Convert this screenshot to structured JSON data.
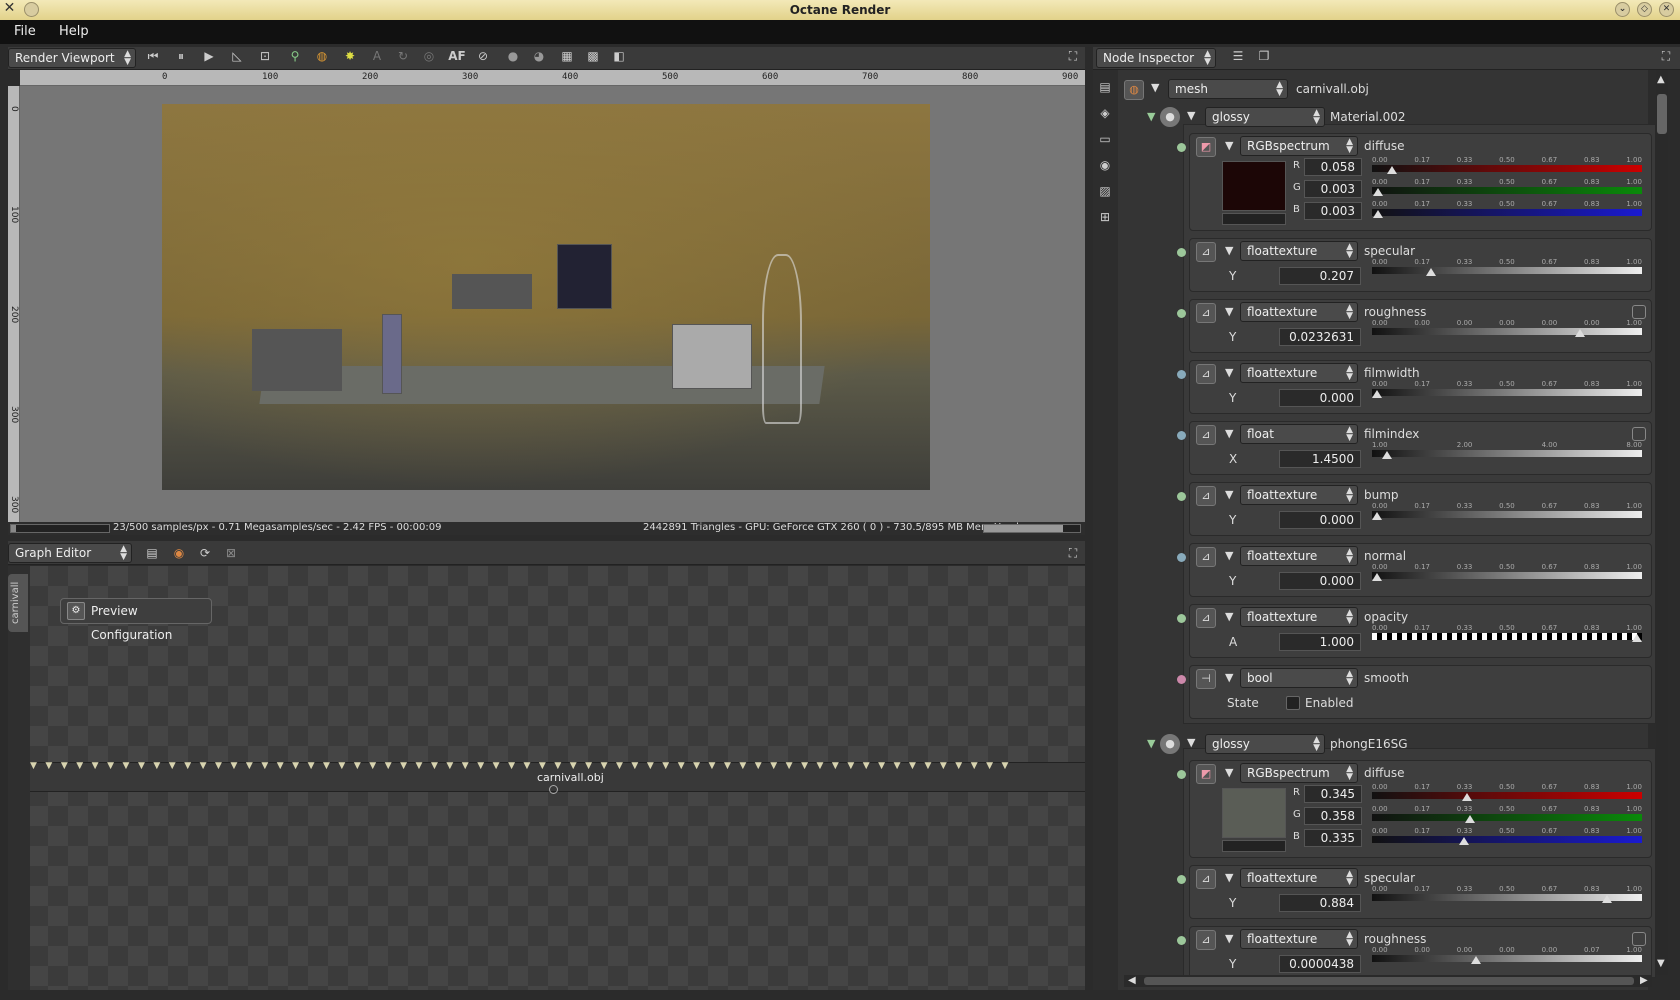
{
  "window": {
    "title": "Octane Render"
  },
  "menu": {
    "items": [
      "File",
      "Help"
    ]
  },
  "viewport": {
    "selector": "Render Viewport",
    "ruler_h": [
      "0",
      "100",
      "200",
      "300",
      "400",
      "500",
      "600",
      "700",
      "800",
      "900"
    ],
    "ruler_v": [
      "0",
      "100",
      "200",
      "300",
      "300"
    ],
    "status_left": "23/500 samples/px - 0.71 Megasamples/sec - 2.42 FPS - 00:00:09",
    "status_right": "2442891 Triangles - GPU: GeForce GTX 260 ( 0 ) - 730.5/895 MB Mem Used",
    "progress_fraction": 0.046,
    "mem_fraction": 0.82,
    "af_label": "AF"
  },
  "graph": {
    "selector": "Graph Editor",
    "tab_label": "carnivall",
    "preview_button": "Preview Configuration",
    "node_label": "carnivall.obj"
  },
  "inspector": {
    "selector": "Node Inspector",
    "root": {
      "type": "mesh",
      "name": "carnivall.obj"
    },
    "materials": [
      {
        "type": "glossy",
        "name": "Material.002",
        "diffuse": {
          "type": "RGBspectrum",
          "label": "diffuse",
          "swatch": "#1c0606",
          "channels": [
            {
              "ch": "R",
              "value": "0.058",
              "frac": 0.058,
              "color": "#cc0000"
            },
            {
              "ch": "G",
              "value": "0.003",
              "frac": 0.003,
              "color": "#0a8a0a"
            },
            {
              "ch": "B",
              "value": "0.003",
              "frac": 0.003,
              "color": "#1a1ad0"
            }
          ]
        },
        "params": [
          {
            "type": "floattexture",
            "label": "specular",
            "ch": "Y",
            "value": "0.207",
            "frac": 0.207,
            "ticks": [
              "0.00",
              "0.17",
              "0.33",
              "0.50",
              "0.67",
              "0.83",
              "1.00"
            ],
            "expand": false
          },
          {
            "type": "floattexture",
            "label": "roughness",
            "ch": "Y",
            "value": "0.0232631",
            "frac": 0.78,
            "ticks": [
              "0.00",
              "0.00",
              "0.00",
              "0.00",
              "0.00",
              "0.00",
              "1.00"
            ],
            "expand": true
          },
          {
            "type": "floattexture",
            "label": "filmwidth",
            "ch": "Y",
            "value": "0.000",
            "frac": 0.0,
            "ticks": [
              "0.00",
              "0.17",
              "0.33",
              "0.50",
              "0.67",
              "0.83",
              "1.00"
            ],
            "expand": false
          },
          {
            "type": "float",
            "label": "filmindex",
            "ch": "X",
            "value": "1.4500",
            "frac": 0.04,
            "ticks": [
              "1.00",
              "2.00",
              "4.00",
              "8.00"
            ],
            "expand": true
          },
          {
            "type": "floattexture",
            "label": "bump",
            "ch": "Y",
            "value": "0.000",
            "frac": 0.0,
            "ticks": [
              "0.00",
              "0.17",
              "0.33",
              "0.50",
              "0.67",
              "0.83",
              "1.00"
            ],
            "expand": false
          },
          {
            "type": "floattexture",
            "label": "normal",
            "ch": "Y",
            "value": "0.000",
            "frac": 0.0,
            "ticks": [
              "0.00",
              "0.17",
              "0.33",
              "0.50",
              "0.67",
              "0.83",
              "1.00"
            ],
            "expand": false
          },
          {
            "type": "floattexture",
            "label": "opacity",
            "ch": "A",
            "value": "1.000",
            "frac": 1.0,
            "ticks": [
              "0.00",
              "0.17",
              "0.33",
              "0.50",
              "0.67",
              "0.83",
              "1.00"
            ],
            "expand": false
          }
        ],
        "smooth": {
          "type": "bool",
          "label": "smooth",
          "state_label": "State",
          "checkbox_label": "Enabled"
        }
      },
      {
        "type": "glossy",
        "name": "phongE16SG",
        "diffuse": {
          "type": "RGBspectrum",
          "label": "diffuse",
          "swatch": "#5a5d56",
          "channels": [
            {
              "ch": "R",
              "value": "0.345",
              "frac": 0.345,
              "color": "#cc0000"
            },
            {
              "ch": "G",
              "value": "0.358",
              "frac": 0.358,
              "color": "#0a8a0a"
            },
            {
              "ch": "B",
              "value": "0.335",
              "frac": 0.335,
              "color": "#1a1ad0"
            }
          ]
        },
        "params": [
          {
            "type": "floattexture",
            "label": "specular",
            "ch": "Y",
            "value": "0.884",
            "frac": 0.884,
            "ticks": [
              "0.00",
              "0.17",
              "0.33",
              "0.50",
              "0.67",
              "0.83",
              "1.00"
            ],
            "expand": false
          },
          {
            "type": "floattexture",
            "label": "roughness",
            "ch": "Y",
            "value": "0.0000438",
            "frac": 0.38,
            "ticks": [
              "0.00",
              "0.00",
              "0.00",
              "0.00",
              "0.00",
              "0.07",
              "1.00"
            ],
            "expand": true
          }
        ]
      }
    ]
  }
}
